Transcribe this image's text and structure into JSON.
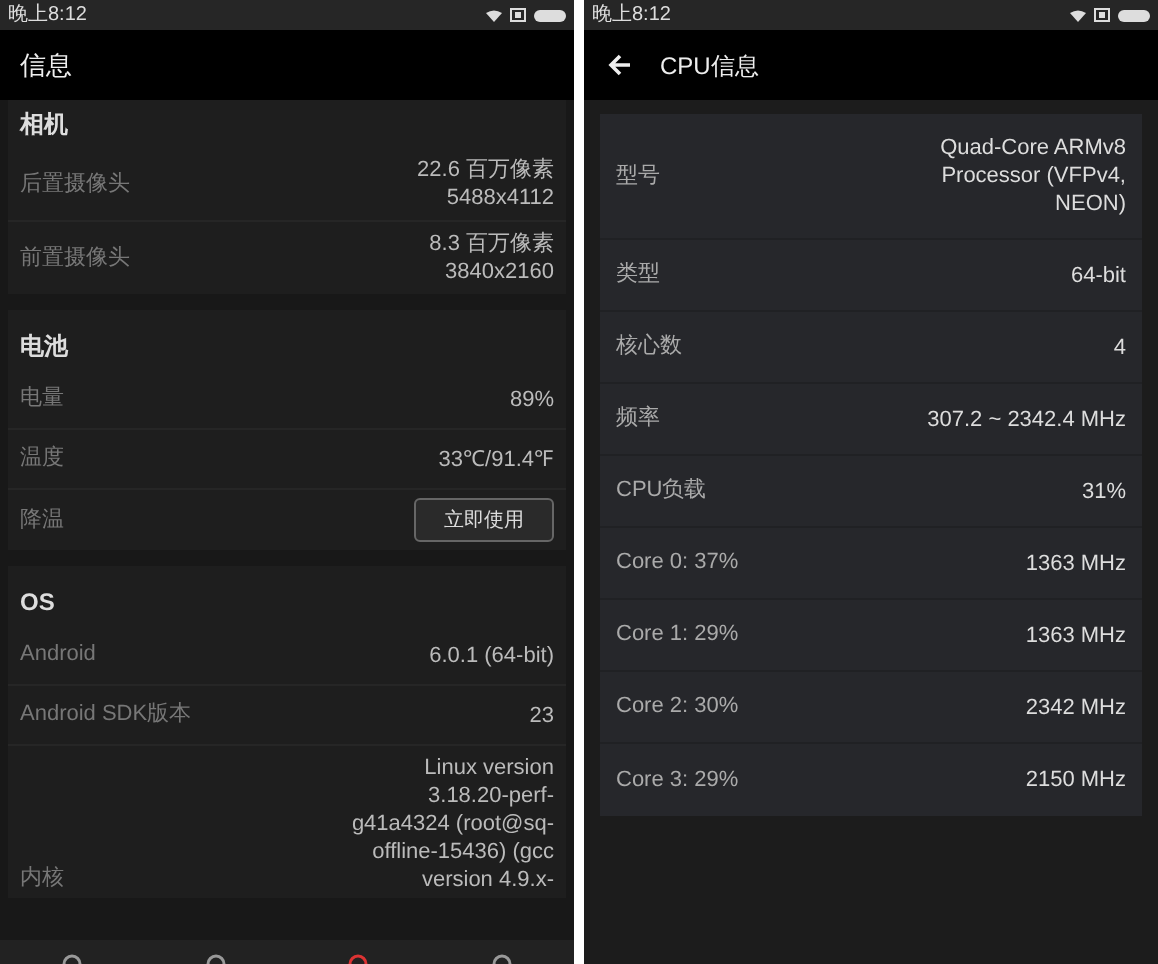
{
  "left": {
    "status_bar": {
      "time": "晚上8:12"
    },
    "header": {
      "title": "信息"
    },
    "sections": [
      {
        "title": "相机",
        "rows": [
          {
            "kind": "text",
            "label": "后置摄像头",
            "value": [
              "22.6 百万像素",
              "5488x4112"
            ]
          },
          {
            "kind": "text",
            "label": "前置摄像头",
            "value": [
              "8.3 百万像素",
              "3840x2160"
            ]
          }
        ]
      },
      {
        "title": "电池",
        "rows": [
          {
            "kind": "text",
            "label": "电量",
            "value": [
              "89%"
            ]
          },
          {
            "kind": "text",
            "label": "温度",
            "value": [
              "33℃/91.4℉"
            ]
          },
          {
            "kind": "button",
            "label": "降温",
            "value": [
              "立即使用"
            ]
          }
        ]
      },
      {
        "title": "OS",
        "rows": [
          {
            "kind": "text",
            "label": "Android",
            "value": [
              "6.0.1 (64-bit)"
            ]
          },
          {
            "kind": "text",
            "label": "Android SDK版本",
            "value": [
              "23"
            ]
          },
          {
            "kind": "text",
            "label": "内核",
            "value": [
              "Linux version",
              "3.18.20-perf-",
              "g41a4324 (root@sq-",
              "offline-15436) (gcc",
              "version 4.9.x-"
            ]
          }
        ]
      }
    ]
  },
  "right": {
    "status_bar": {
      "time": "晚上8:12"
    },
    "header": {
      "title": "CPU信息"
    },
    "rows": [
      {
        "label": "型号",
        "value": [
          "Quad-Core ARMv8",
          "Processor (VFPv4,",
          "NEON)"
        ]
      },
      {
        "label": "类型",
        "value": [
          "64-bit"
        ]
      },
      {
        "label": "核心数",
        "value": [
          "4"
        ]
      },
      {
        "label": "频率",
        "value": [
          "307.2 ~ 2342.4 MHz"
        ]
      },
      {
        "label": "CPU负载",
        "value": [
          "31%"
        ]
      },
      {
        "label": "Core 0: 37%",
        "value": [
          "1363 MHz"
        ]
      },
      {
        "label": "Core 1: 29%",
        "value": [
          "1363 MHz"
        ]
      },
      {
        "label": "Core 2: 30%",
        "value": [
          "2342 MHz"
        ]
      },
      {
        "label": "Core 3: 29%",
        "value": [
          "2150 MHz"
        ]
      }
    ]
  }
}
